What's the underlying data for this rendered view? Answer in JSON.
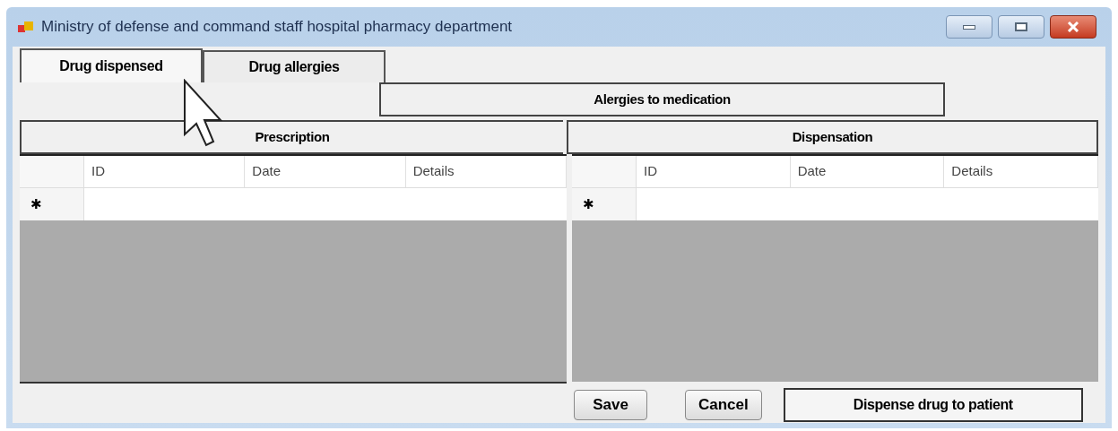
{
  "window": {
    "title": "Ministry of defense and command staff hospital pharmacy department"
  },
  "tabs": [
    {
      "label": "Drug dispensed",
      "selected": true
    },
    {
      "label": "Drug allergies",
      "selected": false
    }
  ],
  "allergies_button": "Alergies to medication",
  "grids": [
    {
      "title": "Prescription",
      "columns": [
        "ID",
        "Date",
        "Details"
      ],
      "new_row_marker": "✱"
    },
    {
      "title": "Dispensation",
      "columns": [
        "ID",
        "Date",
        "Details"
      ],
      "new_row_marker": "✱"
    }
  ],
  "buttons": [
    {
      "label": "Save",
      "kind": "normal"
    },
    {
      "label": "Cancel",
      "kind": "normal"
    },
    {
      "label": "Dispense drug to patient",
      "kind": "wide"
    }
  ]
}
